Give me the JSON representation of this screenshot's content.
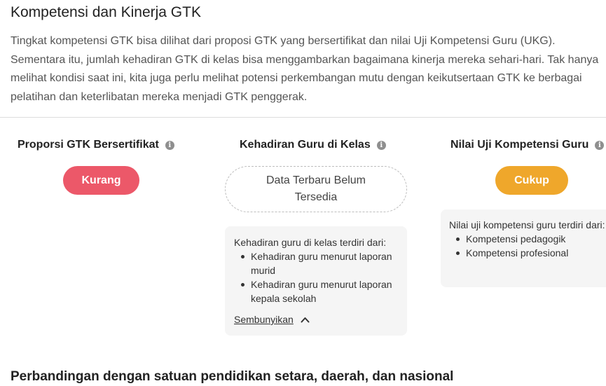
{
  "header": {
    "title": "Kompetensi dan Kinerja GTK",
    "description": "Tingkat kompetensi GTK bisa dilihat dari proposi GTK yang bersertifikat dan nilai Uji Kompetensi Guru (UKG). Sementara itu, jumlah kehadiran GTK di kelas bisa menggambarkan bagaimana kinerja mereka sehari-hari. Tak hanya melihat kondisi saat ini, kita juga perlu melihat potensi perkembangan mutu dengan keikutsertaan GTK ke berbagai pelatihan dan keterlibatan mereka menjadi GTK penggerak."
  },
  "metrics": {
    "certified": {
      "title": "Proporsi GTK Bersertifikat",
      "status": "Kurang",
      "status_color": "#ec5869"
    },
    "attendance": {
      "title": "Kehadiran Guru di Kelas",
      "status": "Data Terbaru Belum Tersedia",
      "info_intro": "Kehadiran guru di kelas terdiri dari:",
      "info_items": [
        "Kehadiran guru menurut laporan murid",
        "Kehadiran guru menurut laporan kepala sekolah"
      ],
      "hide_label": "Sembunyikan"
    },
    "ukg": {
      "title": "Nilai Uji Kompetensi Guru",
      "status": "Cukup",
      "status_color": "#efa72b",
      "info_intro": "Nilai uji kompetensi guru terdiri dari:",
      "info_items": [
        "Kompetensi pedagogik",
        "Kompetensi profesional"
      ]
    }
  },
  "comparison": {
    "title": "Perbandingan dengan satuan pendidikan setara, daerah, dan nasional"
  },
  "icons": {
    "info": "info-icon",
    "chevron": "chevron-up-icon"
  }
}
